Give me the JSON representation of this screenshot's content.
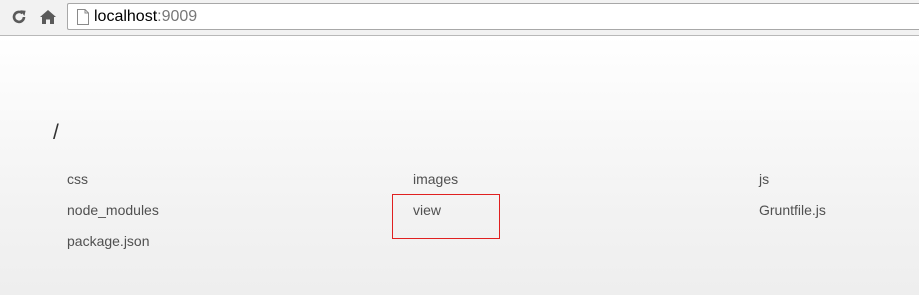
{
  "browser": {
    "url_host": "localhost",
    "url_port": ":9009",
    "icons": {
      "reload": "reload-icon",
      "home": "home-icon",
      "page": "page-icon"
    }
  },
  "listing": {
    "title": "/",
    "entries": [
      "css",
      "images",
      "js",
      "node_modules",
      "view",
      "Gruntfile.js",
      "package.json"
    ]
  },
  "annotation": {
    "highlight_color": "#e02020",
    "highlighted_entry": "view"
  },
  "colors": {
    "link_text": "#505050",
    "title_text": "#333333",
    "toolbar_bg": "#f2f2f2"
  }
}
